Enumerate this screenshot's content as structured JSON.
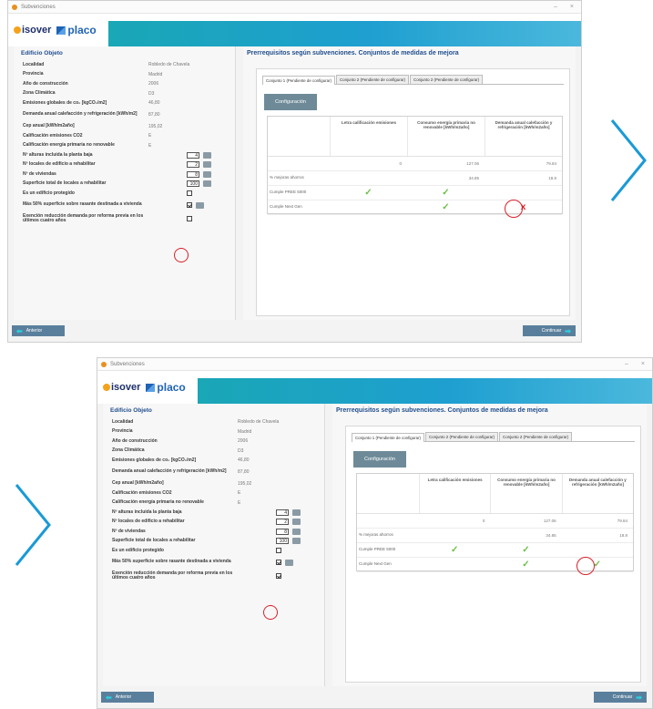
{
  "window": {
    "app_title": "Subvenciones",
    "brand_isover": "isover",
    "brand_placo": "placo"
  },
  "left_panel": {
    "title": "Edificio Objeto",
    "fields": [
      {
        "label": "Localidad",
        "value": "Robledo de Chavela"
      },
      {
        "label": "Provincia",
        "value": "Madrid"
      },
      {
        "label": "Año de construcción",
        "value": "2006"
      },
      {
        "label": "Zona Climática",
        "value": "D3"
      },
      {
        "label": "Emisiones globales de co₂ [kgCO₂/m2]",
        "value": "46,80"
      },
      {
        "label": "Demanda anual calefacción y refrigeración [kWh/m2]",
        "value": "87,80"
      },
      {
        "label": "Cep anual [kWh/m2año]",
        "value": "195,02"
      },
      {
        "label": "Calificación emisiones CO2",
        "value": "E"
      },
      {
        "label": "Calificación energía primaria no renovable",
        "value": "E"
      }
    ],
    "controls": [
      {
        "label": "Nº alturas incluida la planta baja",
        "number": "4"
      },
      {
        "label": "Nº locales de edificio a rehabilitar",
        "number": "2"
      },
      {
        "label": "Nº de viviendas",
        "number": "8"
      },
      {
        "label": "Superficie total de locales a rehabilitar",
        "number": "100"
      }
    ],
    "checkboxes": [
      {
        "label": "Es un edificio protegido"
      },
      {
        "label": "Más 50% superficie sobre rasante destinada a vivienda"
      },
      {
        "label": "Exención reducción demanda por reforma previa en los últimos cuatro años"
      }
    ]
  },
  "right_panel": {
    "title": "Prerrequisitos según subvenciones. Conjuntos de medidas de mejora",
    "tabs": [
      "Conjunto 1 (Pendiente de configurar)",
      "Conjunto 2 (Pendiente de configurar)",
      "Conjunto 2 (Pendiente de configurar)"
    ],
    "config_button": "Configuración",
    "columns": [
      "Letra calificación emisiones",
      "Consumo energía primaria no renovable [kWh/m2año]",
      "Demanda anual calefacción y refrigeración [kWh/m2año]"
    ],
    "row_values": [
      "0",
      "127.06",
      "79.84"
    ],
    "row_savings_label": "% mejoras ahorros",
    "row_savings": [
      "34.85",
      "18.8"
    ],
    "row_pree_label": "Cumple PREE 5000",
    "row_ngen_label": "Cumple Next Gen"
  },
  "nav": {
    "prev_label": "Anterior",
    "next_label": "Continuar"
  },
  "colors": {
    "accent_teal": "#1aa7b6",
    "check_green": "#6cc04a",
    "alert_red": "#d8212a",
    "chevron_blue": "#1a9ad6"
  }
}
